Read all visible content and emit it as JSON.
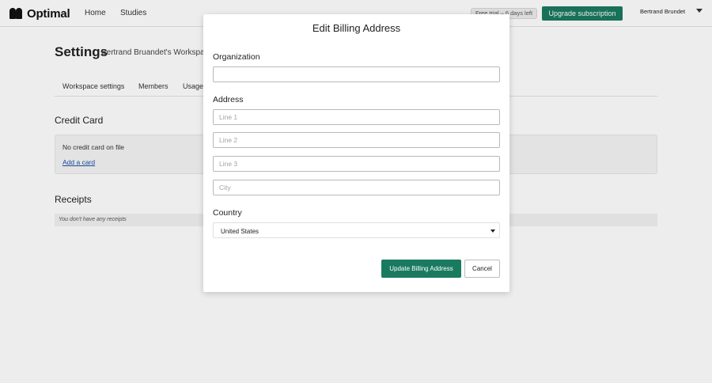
{
  "header": {
    "brand": "Optimal",
    "nav": [
      "Home",
      "Studies"
    ],
    "trial_badge": "Free trial – 6 days left",
    "upgrade_label": "Upgrade subscription",
    "user_name": "Bertrand Brundet"
  },
  "page": {
    "title": "Settings",
    "subtitle": "Bertrand Bruandet's Workspace",
    "tabs": [
      "Workspace settings",
      "Members",
      "Usage"
    ],
    "credit_card": {
      "title": "Credit Card",
      "empty_text": "No credit card on file",
      "add_link": "Add a card"
    },
    "receipts": {
      "title": "Receipts",
      "empty_text": "You don't have any receipts"
    }
  },
  "modal": {
    "title": "Edit Billing Address",
    "organization_label": "Organization",
    "organization_value": "",
    "address_label": "Address",
    "address_placeholders": [
      "Line 1",
      "Line 2",
      "Line 3",
      "City"
    ],
    "country_label": "Country",
    "country_value": "United States",
    "submit_label": "Update Billing Address",
    "cancel_label": "Cancel"
  }
}
